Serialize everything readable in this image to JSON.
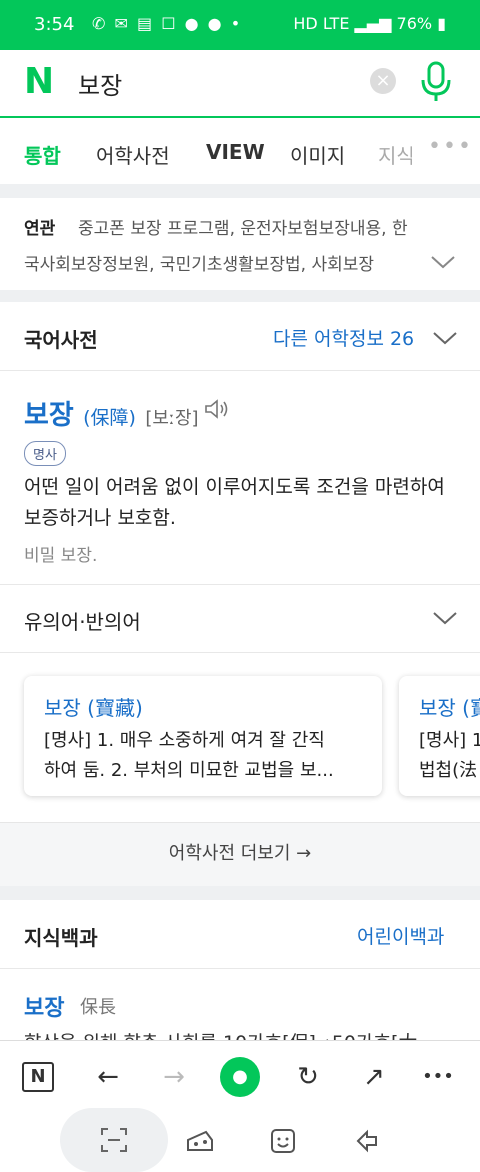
{
  "status": {
    "time": "3:54",
    "battery": "76%",
    "network": "HD LTE"
  },
  "search": {
    "query": "보장"
  },
  "tabs": [
    "통합",
    "어학사전",
    "VIEW",
    "이미지",
    "지식"
  ],
  "related": {
    "label": "연관",
    "line1": "중고폰 보장 프로그램, 운전자보험보장내용, 한",
    "line2": "국사회보장정보원, 국민기초생활보장법, 사회보장"
  },
  "dictionary": {
    "title": "국어사전",
    "other_label": "다른 어학정보",
    "other_count": "26",
    "word": "보장",
    "hanja": "(保障)",
    "pronunciation": "[보ː장]",
    "pos": "명사",
    "definition": "어떤 일이 어려움 없이 이루어지도록 조건을 마련하여 보증하거나 보호함.",
    "example": "비밀 보장.",
    "synonyms_title": "유의어·반의어",
    "cards": [
      {
        "title": "보장 (寶藏)",
        "line1": "[명사] 1. 매우 소중하게 여겨 잘 간직",
        "line2": "하여 둠. 2. 부처의 미묘한 교법을 보..."
      },
      {
        "title": "보장 (寶",
        "line1": "[명사] 1",
        "line2": "법첩(法"
      }
    ],
    "more_label": "어학사전 더보기 →"
  },
  "encyclopedia": {
    "title": "지식백과",
    "link": "어린이백과",
    "word": "보장",
    "hanja": "保長",
    "snippet": "향상을 위해 향촌 사회를 10가호[保]→50가호[大"
  },
  "toolbar": [
    "N",
    "←",
    "→",
    "●",
    "↻",
    "↗",
    "•••"
  ]
}
